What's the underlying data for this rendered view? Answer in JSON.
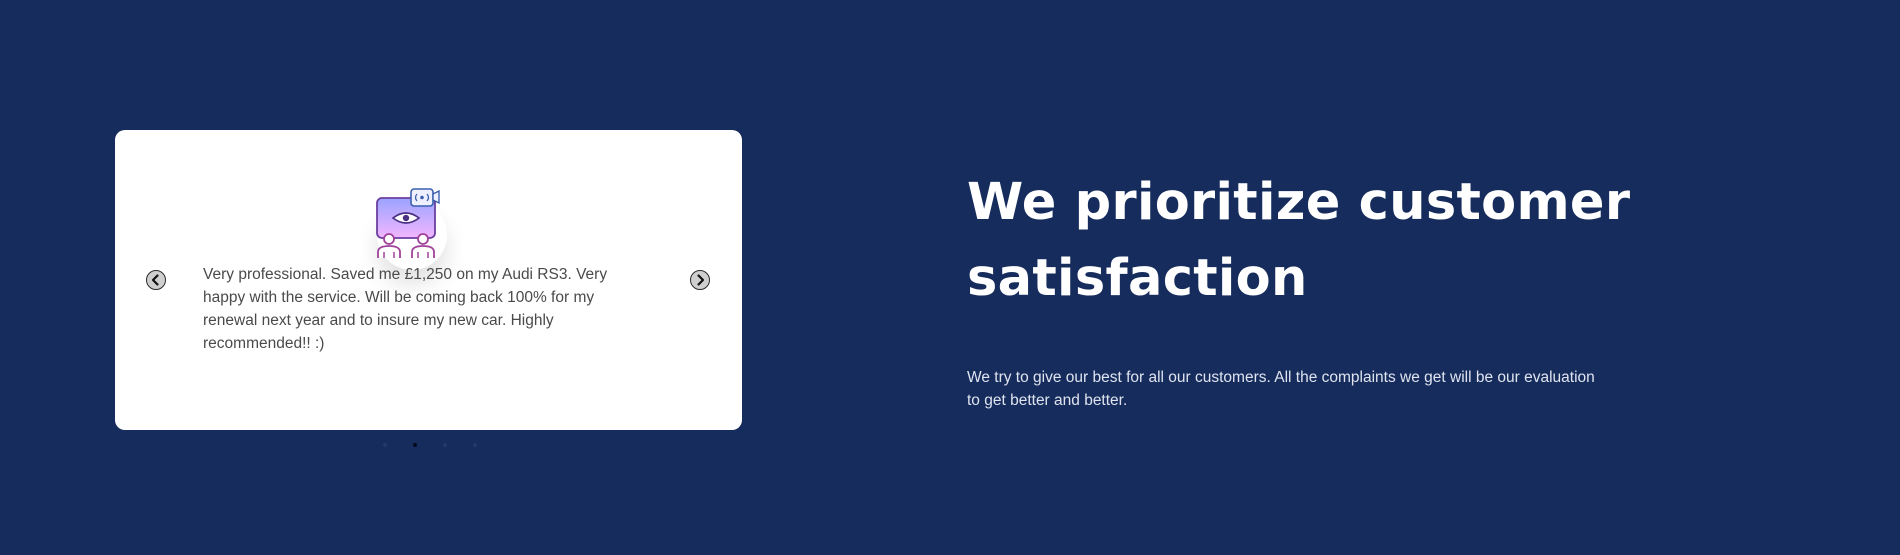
{
  "colors": {
    "background": "#162c5d",
    "card": "#ffffff",
    "heading": "#ffffff",
    "body_text": "#4a4a4a",
    "subtext": "#dfe4ef"
  },
  "testimonial": {
    "avatar_icon": "security-camera-users-icon",
    "quote": "Very professional. Saved me £1,250 on my Audi RS3. Very happy with the service. Will be coming back 100% for my renewal next year and to insure my new car. Highly recommended!! :)",
    "prev_icon": "chevron-left-icon",
    "next_icon": "chevron-right-icon",
    "slide_count": 4,
    "active_slide": 2
  },
  "hero": {
    "heading": "We prioritize customer satisfaction",
    "subtext": "We try to give our best for all our customers. All the complaints we get will be our evaluation to get better and better."
  }
}
